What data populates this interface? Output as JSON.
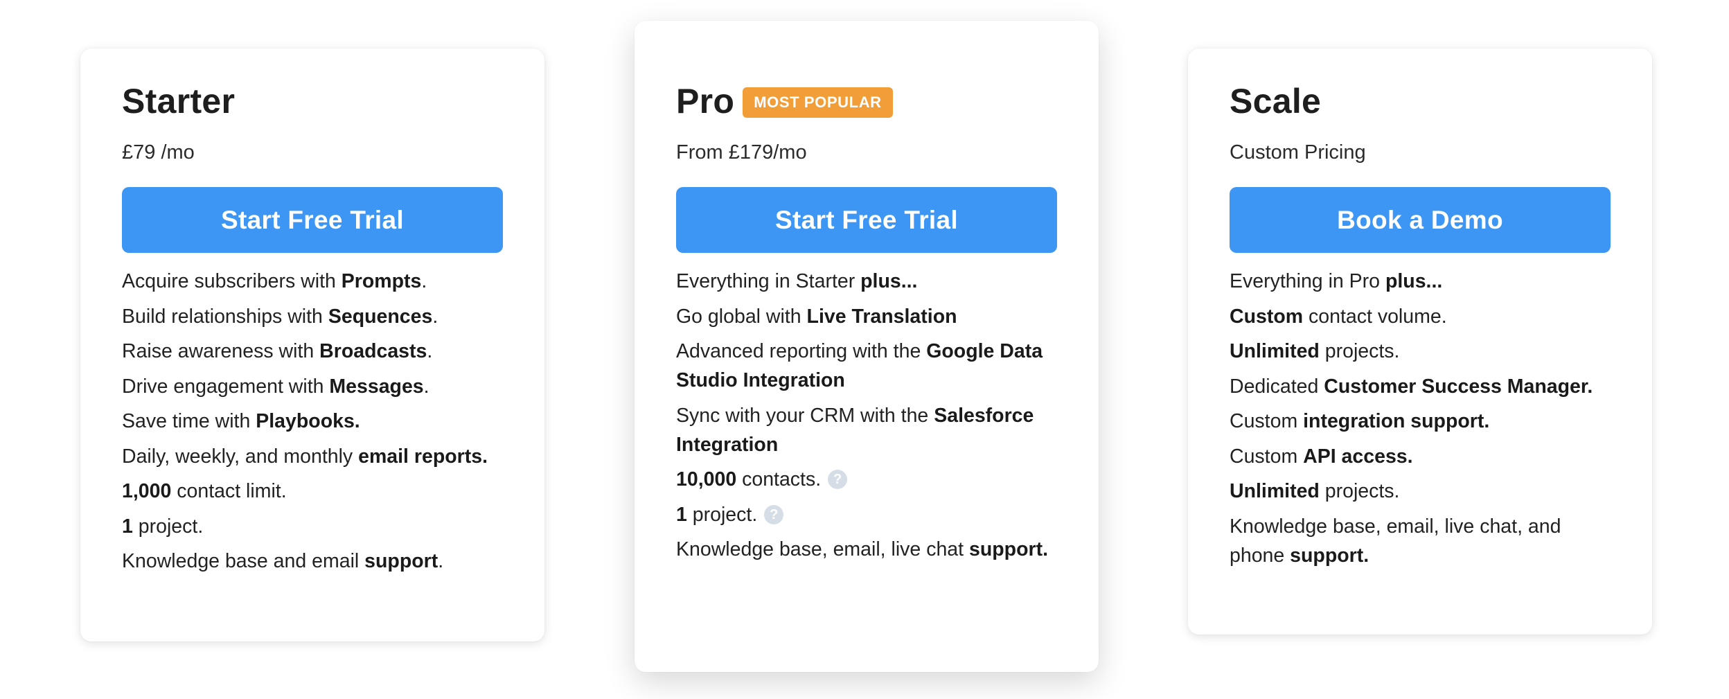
{
  "plans": [
    {
      "title": "Starter",
      "price": "£79 /mo",
      "cta": "Start Free Trial",
      "features": [
        {
          "text": "Acquire subscribers with ",
          "bold": "Prompts",
          "after": "."
        },
        {
          "text": "Build relationships with ",
          "bold": "Sequences",
          "after": "."
        },
        {
          "text": "Raise awareness with ",
          "bold": "Broadcasts",
          "after": "."
        },
        {
          "text": "Drive engagement with ",
          "bold": "Messages",
          "after": "."
        },
        {
          "text": "Save time with ",
          "bold": "Playbooks.",
          "after": ""
        },
        {
          "text": "Daily, weekly, and monthly ",
          "bold": "email reports.",
          "after": ""
        },
        {
          "bold_first": "1,000",
          "text": " contact limit."
        },
        {
          "bold_first": "1",
          "text": " project."
        },
        {
          "text": "Knowledge base and email ",
          "bold": "support",
          "after": "."
        }
      ]
    },
    {
      "title": "Pro",
      "badge": "MOST POPULAR",
      "price": "From £179/mo",
      "cta": "Start Free Trial",
      "features": [
        {
          "text": "Everything in Starter ",
          "bold": "plus...",
          "after": ""
        },
        {
          "text": "Go global with ",
          "bold": "Live Translation",
          "after": ""
        },
        {
          "text": "Advanced reporting with the ",
          "bold": "Google Data Studio Integration",
          "after": ""
        },
        {
          "text": "Sync with your CRM with the ",
          "bold": "Salesforce Integration",
          "after": ""
        },
        {
          "bold_first": "10,000",
          "text": " contacts.",
          "help_icon": "question-circle-icon"
        },
        {
          "bold_first": "1",
          "text": " project.",
          "help_icon": "question-circle-icon"
        },
        {
          "text": "Knowledge base, email, live chat ",
          "bold": "support.",
          "after": ""
        }
      ]
    },
    {
      "title": "Scale",
      "price": "Custom Pricing",
      "cta": "Book a Demo",
      "features": [
        {
          "text": "Everything in Pro ",
          "bold": "plus...",
          "after": ""
        },
        {
          "bold_first": "Custom",
          "text": " contact volume."
        },
        {
          "bold_first": "Unlimited",
          "text": " projects."
        },
        {
          "text": "Dedicated ",
          "bold": "Customer Success Manager.",
          "after": ""
        },
        {
          "text": "Custom ",
          "bold": "integration support.",
          "after": ""
        },
        {
          "text": "Custom ",
          "bold": "API access.",
          "after": ""
        },
        {
          "bold_first": "Unlimited",
          "text": " projects."
        },
        {
          "text": "Knowledge base, email, live chat, and phone ",
          "bold": "support.",
          "after": ""
        }
      ]
    }
  ],
  "colors": {
    "cta_blue": "#3d95f4",
    "badge_orange": "#f29e38",
    "help_icon_gray": "#d5dde6"
  }
}
